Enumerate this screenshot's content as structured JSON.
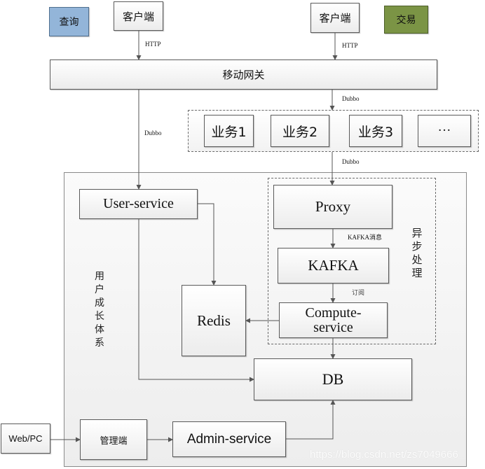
{
  "legend": {
    "query": {
      "label": "查询",
      "color": "#93b5d9"
    },
    "trade": {
      "label": "交易",
      "color": "#7b9445"
    }
  },
  "clients": {
    "left": "客户端",
    "right": "客户端"
  },
  "protocols": {
    "http_left": "HTTP",
    "http_right": "HTTP",
    "dubbo_gateway_to_business": "Dubbo",
    "dubbo_gateway_to_user": "Dubbo",
    "dubbo_business_to_proxy": "Dubbo",
    "kafka_message": "KAFKA消息",
    "subscribe": "订阅"
  },
  "gateway": "移动网关",
  "business": [
    "业务1",
    "业务2",
    "业务3",
    "···"
  ],
  "growth_system": {
    "title_chars": [
      "用",
      "户",
      "成",
      "长",
      "体",
      "系"
    ],
    "user_service": "User-service",
    "redis": "Redis",
    "db": "DB",
    "async": {
      "title_chars": [
        "异",
        "步",
        "处",
        "理"
      ],
      "proxy": "Proxy",
      "kafka": "KAFKA",
      "compute_line1": "Compute-",
      "compute_line2": "service"
    },
    "admin_client": "管理端",
    "admin_service": "Admin-service"
  },
  "web_pc": "Web/PC",
  "watermark": "https://blog.csdn.net/zs7049666"
}
